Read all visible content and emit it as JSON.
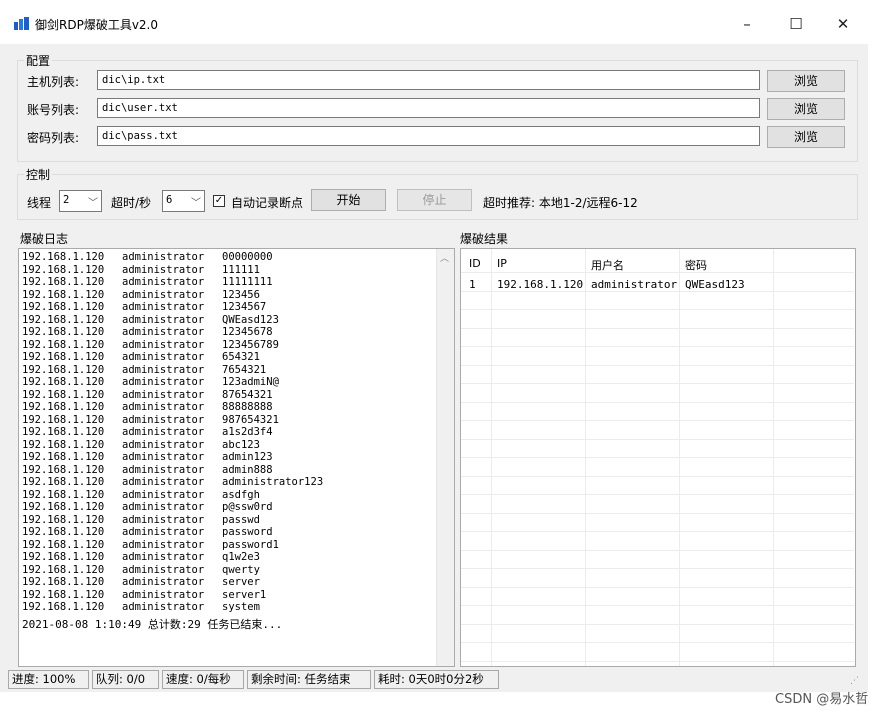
{
  "window": {
    "title": "御剑RDP爆破工具v2.0",
    "minimize": "–",
    "maximize": "☐",
    "close": "✕"
  },
  "config": {
    "legend": "配置",
    "host_label": "主机列表:",
    "host_value": "dic\\ip.txt",
    "user_label": "账号列表:",
    "user_value": "dic\\user.txt",
    "pass_label": "密码列表:",
    "pass_value": "dic\\pass.txt",
    "browse": "浏览"
  },
  "control": {
    "legend": "控制",
    "threads_label": "线程",
    "threads_value": "2",
    "timeout_label": "超时/秒",
    "timeout_value": "6",
    "autosave_label": "自动记录断点",
    "autosave_checked": true,
    "start": "开始",
    "stop": "停止",
    "hint": "超时推荐: 本地1-2/远程6-12"
  },
  "log": {
    "title": "爆破日志",
    "rows": [
      [
        "192.168.1.120",
        "administrator",
        "00000000"
      ],
      [
        "192.168.1.120",
        "administrator",
        "111111"
      ],
      [
        "192.168.1.120",
        "administrator",
        "11111111"
      ],
      [
        "192.168.1.120",
        "administrator",
        "123456"
      ],
      [
        "192.168.1.120",
        "administrator",
        "1234567"
      ],
      [
        "192.168.1.120",
        "administrator",
        "QWEasd123"
      ],
      [
        "192.168.1.120",
        "administrator",
        "12345678"
      ],
      [
        "192.168.1.120",
        "administrator",
        "123456789"
      ],
      [
        "192.168.1.120",
        "administrator",
        "654321"
      ],
      [
        "192.168.1.120",
        "administrator",
        "7654321"
      ],
      [
        "192.168.1.120",
        "administrator",
        "123admiN@"
      ],
      [
        "192.168.1.120",
        "administrator",
        "87654321"
      ],
      [
        "192.168.1.120",
        "administrator",
        "88888888"
      ],
      [
        "192.168.1.120",
        "administrator",
        "987654321"
      ],
      [
        "192.168.1.120",
        "administrator",
        "a1s2d3f4"
      ],
      [
        "192.168.1.120",
        "administrator",
        "abc123"
      ],
      [
        "192.168.1.120",
        "administrator",
        "admin123"
      ],
      [
        "192.168.1.120",
        "administrator",
        "admin888"
      ],
      [
        "192.168.1.120",
        "administrator",
        "administrator123"
      ],
      [
        "192.168.1.120",
        "administrator",
        "asdfgh"
      ],
      [
        "192.168.1.120",
        "administrator",
        "p@ssw0rd"
      ],
      [
        "192.168.1.120",
        "administrator",
        "passwd"
      ],
      [
        "192.168.1.120",
        "administrator",
        "password"
      ],
      [
        "192.168.1.120",
        "administrator",
        "password1"
      ],
      [
        "192.168.1.120",
        "administrator",
        "q1w2e3"
      ],
      [
        "192.168.1.120",
        "administrator",
        "qwerty"
      ],
      [
        "192.168.1.120",
        "administrator",
        "server"
      ],
      [
        "192.168.1.120",
        "administrator",
        "server1"
      ],
      [
        "192.168.1.120",
        "administrator",
        "system"
      ]
    ],
    "summary": "2021-08-08 1:10:49 总计数:29 任务已结束..."
  },
  "results": {
    "title": "爆破结果",
    "columns": [
      "ID",
      "IP",
      "用户名",
      "密码"
    ],
    "rows": [
      [
        "1",
        "192.168.1.120",
        "administrator",
        "QWEasd123"
      ]
    ]
  },
  "status": {
    "progress": "进度: 100%",
    "queue": "队列: 0/0",
    "speed": "速度: 0/每秒",
    "remaining": "剩余时间: 任务结束",
    "elapsed": "耗时: 0天0时0分2秒"
  },
  "watermark": "CSDN @易水哲"
}
